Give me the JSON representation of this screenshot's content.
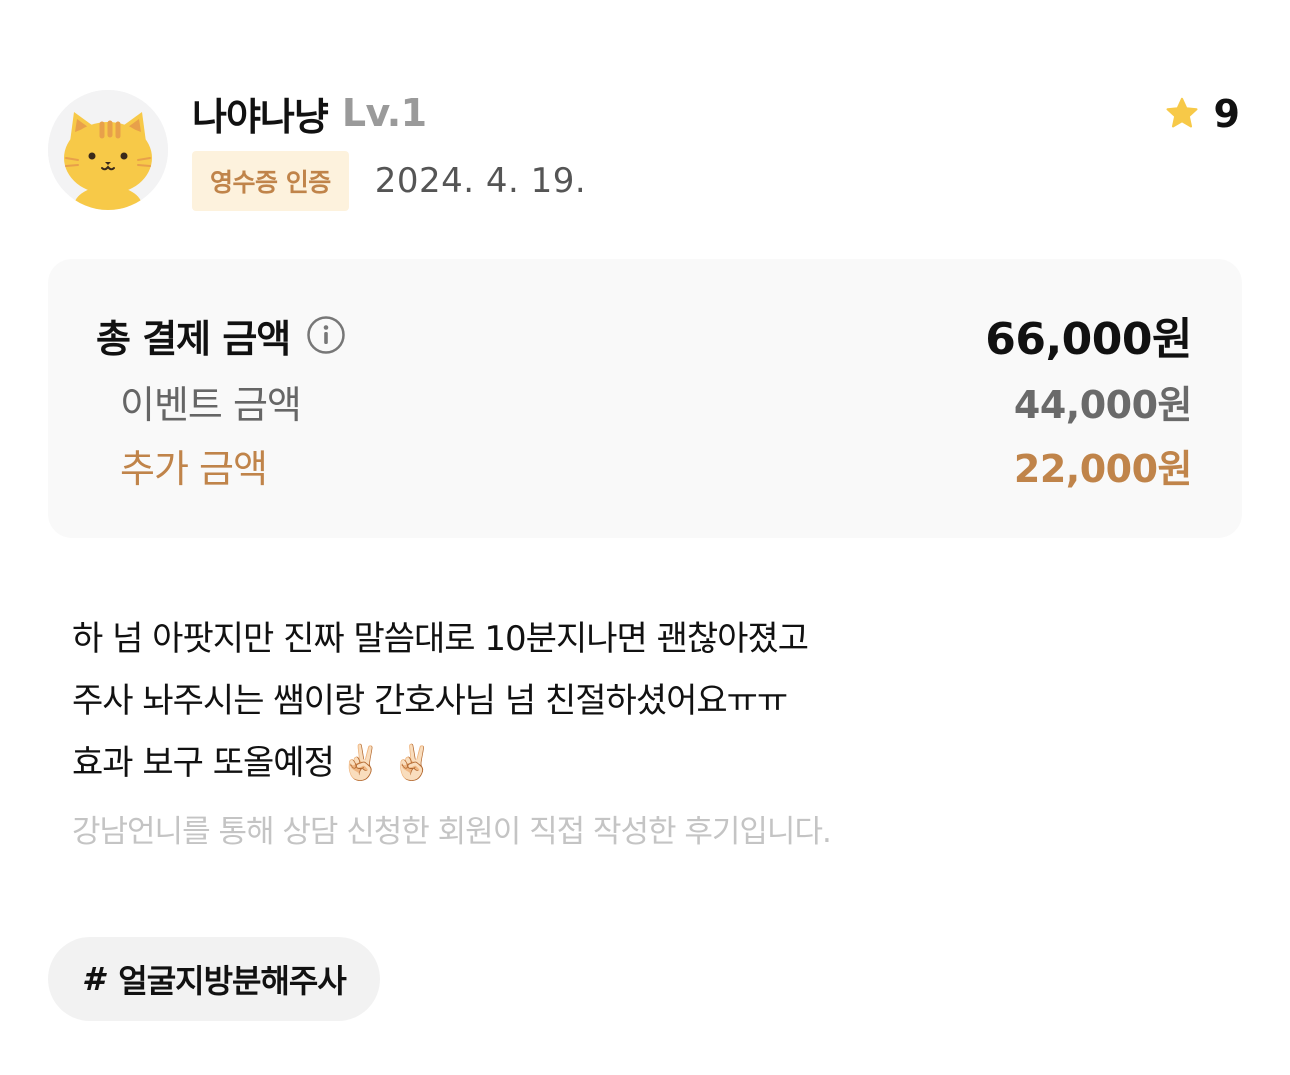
{
  "reviewer": {
    "avatar_icon": "cat-face-icon",
    "username": "나야나냥",
    "level": "Lv.1",
    "badge": "영수증 인증",
    "date": "2024. 4. 19."
  },
  "rating": {
    "icon": "star-icon",
    "value": "9"
  },
  "price": {
    "total_label": "총 결제 금액",
    "total_amount": "66,000원",
    "info_icon": "info-icon",
    "event_label": "이벤트 금액",
    "event_amount": "44,000원",
    "extra_label": "추가 금액",
    "extra_amount": "22,000원"
  },
  "review": {
    "lines": [
      "하 넘 아팟지만 진짜 말씀대로 10분지나면 괜찮아졌고",
      "주사 놔주시는 쌤이랑 간호사님 넘 친절하셨어요ㅠㅠ",
      "효과 보구 또올예정"
    ],
    "emoji": "✌🏻 ✌🏻",
    "disclaimer": "강남언니를 통해 상담 신청한 회원이 직접 작성한 후기입니다."
  },
  "tag": {
    "hash": "#",
    "label": "얼굴지방분해주사"
  },
  "colors": {
    "accent": "#c0844a",
    "badge_bg": "#fdf2dd",
    "star": "#f7c948",
    "card_bg": "#f9f9f9"
  }
}
